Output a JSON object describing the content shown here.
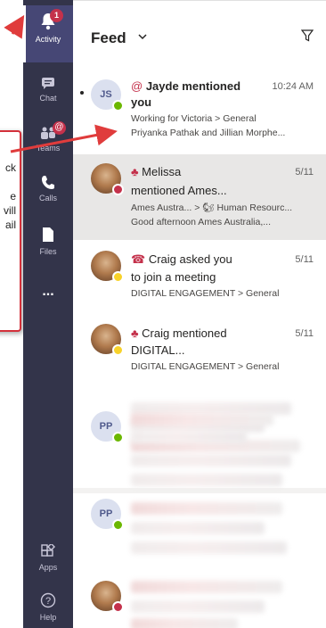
{
  "rail": {
    "items": [
      {
        "label": "Activity",
        "badge": "1"
      },
      {
        "label": "Chat"
      },
      {
        "label": "Teams",
        "badge": "@"
      },
      {
        "label": "Calls"
      },
      {
        "label": "Files"
      },
      {
        "label": "..."
      },
      {
        "label": "Apps"
      },
      {
        "label": "Help"
      }
    ]
  },
  "callout": {
    "lines": [
      "ck",
      "e",
      "vill",
      "ail"
    ]
  },
  "feed": {
    "title": "Feed",
    "items": [
      {
        "initials": "JS",
        "type_icon": "@",
        "title": "Jayde mentioned",
        "title2": "you",
        "time": "10:24 AM",
        "sub": "Working for Victoria > General",
        "preview": "Priyanka Pathak and Jillian Morphe..."
      },
      {
        "type_icon": "♣",
        "title": "Melissa",
        "title2": "mentioned Ames...",
        "time": "5/11",
        "sub": "Ames Austra... > 🐿 Human Resourc...",
        "preview": "Good afternoon Ames Australia,..."
      },
      {
        "type_icon": "☎",
        "title": "Craig asked you",
        "title2": "to join a meeting",
        "time": "5/11",
        "sub": "DIGITAL ENGAGEMENT > General"
      },
      {
        "type_icon": "♣",
        "title": "Craig mentioned",
        "title2": "DIGITAL...",
        "time": "5/11",
        "sub": "DIGITAL ENGAGEMENT > General"
      },
      {
        "initials": "PP"
      },
      {
        "initials": "PP"
      }
    ]
  },
  "colors": {
    "rail": "#33344a",
    "accent": "#c4314b",
    "arrow": "#e03c3c"
  }
}
